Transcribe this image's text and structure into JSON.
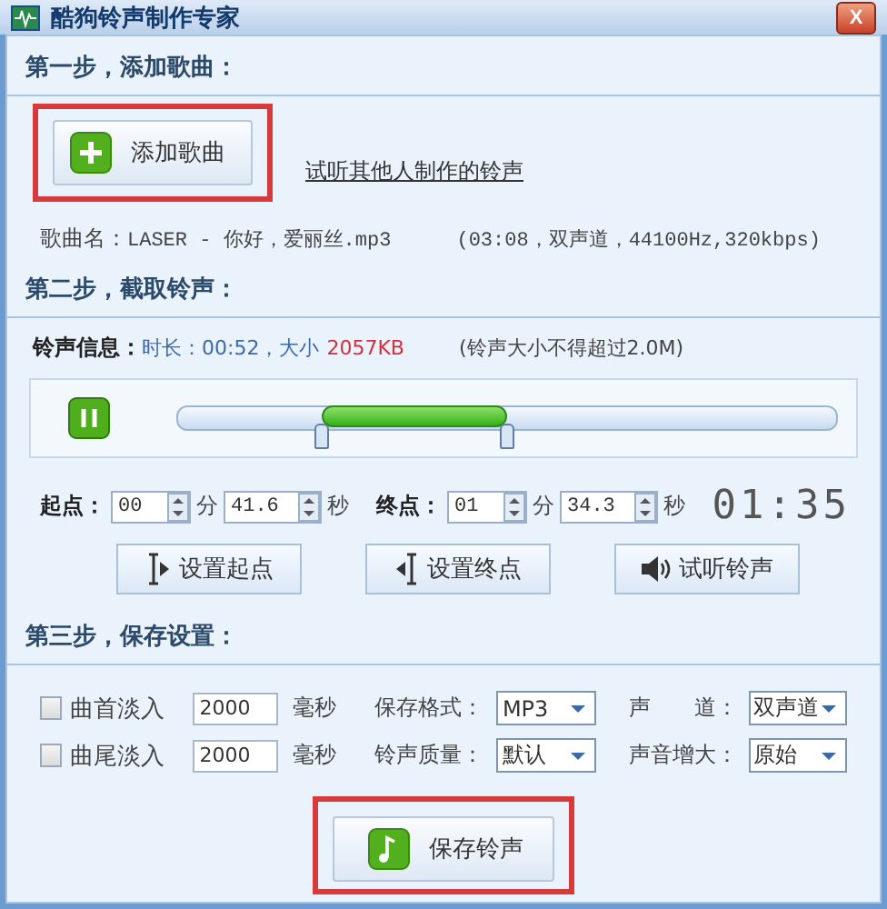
{
  "window": {
    "title": "酷狗铃声制作专家",
    "close": "X"
  },
  "step1": {
    "heading": "第一步，添加歌曲：",
    "add_button": "添加歌曲",
    "link": "试听其他人制作的铃声",
    "song_label": "歌曲名：",
    "song_name": "LASER - 你好，爱丽丝.mp3",
    "song_info": "(03:08，双声道，44100Hz,320kbps)"
  },
  "step2": {
    "heading": "第二步，截取铃声：",
    "info_label": "铃声信息：",
    "duration": "时长：00:52，大小",
    "size": "2057KB",
    "limit": "(铃声大小不得超过2.0M)",
    "handles": [
      {
        "kind": "start",
        "level": 0.22
      },
      {
        "kind": "end",
        "level": 0.5
      }
    ],
    "start_label": "起点：",
    "start_min": "00",
    "min_unit": "分",
    "start_sec": "41.6",
    "sec_unit": "秒",
    "end_label": "终点：",
    "end_min": "01",
    "end_min_unit": "分",
    "end_sec": "34.3",
    "end_sec_unit": "秒",
    "clock": "01:35",
    "buttons": [
      {
        "kind": "set_start",
        "label": "设置起点"
      },
      {
        "kind": "set_end",
        "label": "设置终点"
      },
      {
        "kind": "preview",
        "label": "试听铃声"
      }
    ]
  },
  "step3": {
    "heading": "第三步，保存设置：",
    "rows": [
      {
        "fade_label": "曲首淡入",
        "checked": false,
        "fade_ms": "2000",
        "unit": "毫秒",
        "field1_label": "保存格式：",
        "field1_value": "MP3",
        "field2_label": "声　　道：",
        "field2_value": "双声道"
      },
      {
        "fade_label": "曲尾淡入",
        "checked": false,
        "fade_ms": "2000",
        "unit": "毫秒",
        "field1_label": "铃声质量：",
        "field1_value": "默认",
        "field2_label": "声音增大：",
        "field2_value": "原始"
      }
    ],
    "save_button": "保存铃声"
  }
}
